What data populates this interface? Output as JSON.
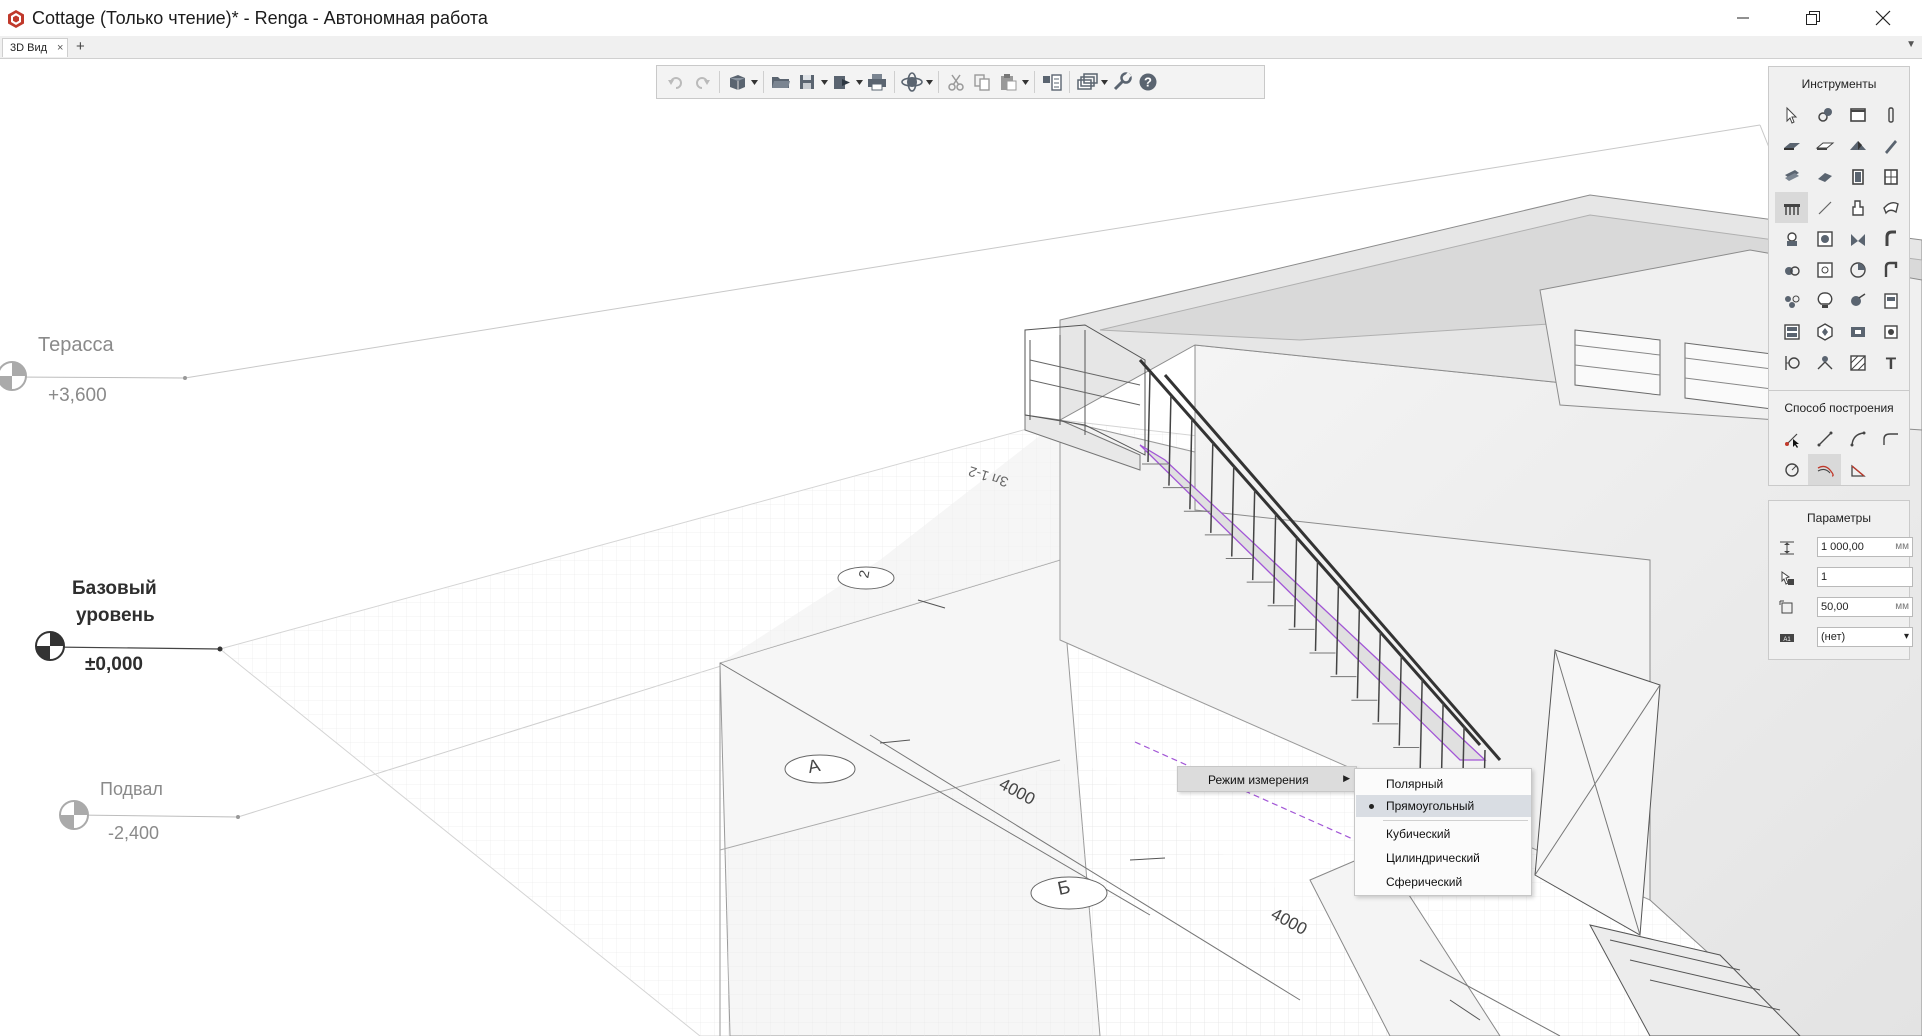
{
  "window": {
    "title": "Cottage (Только чтение)* - Renga - Автономная работа",
    "brand_color": "#c0392b"
  },
  "tabs": [
    {
      "label": "3D Вид",
      "close": "×"
    }
  ],
  "tabbar": {
    "add": "+"
  },
  "levels": {
    "terrace": {
      "name": "Терасса",
      "elevation": "+3,600"
    },
    "base": {
      "name_line1": "Базовый",
      "name_line2": "уровень",
      "elevation": "±0,000"
    },
    "basement": {
      "name": "Подвал",
      "elevation": "-2,400"
    }
  },
  "scene_labels": {
    "axis_a": "А",
    "axis_b": "Б",
    "axis_2": "2",
    "dim_1": "4000",
    "dim_2": "4000",
    "section_label": "Зл 1-2"
  },
  "toolbar": {
    "items": [
      "undo",
      "redo",
      "view-cube",
      "open",
      "save",
      "export",
      "print",
      "orbit",
      "cut",
      "copy",
      "paste",
      "properties",
      "layers",
      "settings",
      "help"
    ]
  },
  "tools_panel": {
    "title": "Инструменты",
    "icons": [
      "select-icon",
      "model-icon",
      "rectangle-icon",
      "column-icon",
      "slab-icon",
      "floor-icon",
      "roof-icon",
      "beam-icon",
      "plate-icon",
      "wall-icon",
      "door-icon",
      "window-icon",
      "stair-icon",
      "line-icon",
      "room-icon",
      "ramp-icon",
      "equipment-icon",
      "fitting-icon",
      "valve-icon",
      "pipe-icon",
      "pump-icon",
      "tank-icon",
      "fan-icon",
      "duct-icon",
      "network-icon",
      "light-icon",
      "switch-icon",
      "panel-icon",
      "assembly-icon",
      "shape-icon",
      "opening-icon",
      "hole-icon",
      "axis-icon",
      "dimension-icon",
      "hatch-icon",
      "text-icon"
    ],
    "active_index": 12
  },
  "method_panel": {
    "title": "Способ построения",
    "icons": [
      "point-icon",
      "line-segment-icon",
      "arc-icon",
      "fillet-icon",
      "circle-icon",
      "polyline-icon",
      "triangle-icon"
    ],
    "active_index": 5
  },
  "params_panel": {
    "title": "Параметры",
    "rows": [
      {
        "icon": "height-icon",
        "value": "1 000,00",
        "unit": "мм"
      },
      {
        "icon": "count-icon",
        "value": "1",
        "unit": ""
      },
      {
        "icon": "offset-icon",
        "value": "50,00",
        "unit": "мм"
      },
      {
        "icon": "style-icon",
        "value": "(нет)",
        "unit": "▾"
      }
    ]
  },
  "context_menu": {
    "main_label": "Режим измерения",
    "sub_items": [
      {
        "label": "Полярный",
        "checked": false
      },
      {
        "label": "Прямоугольный",
        "checked": true
      },
      {
        "label": "Кубический",
        "checked": false
      },
      {
        "label": "Цилиндрический",
        "checked": false
      },
      {
        "label": "Сферический",
        "checked": false
      }
    ]
  }
}
